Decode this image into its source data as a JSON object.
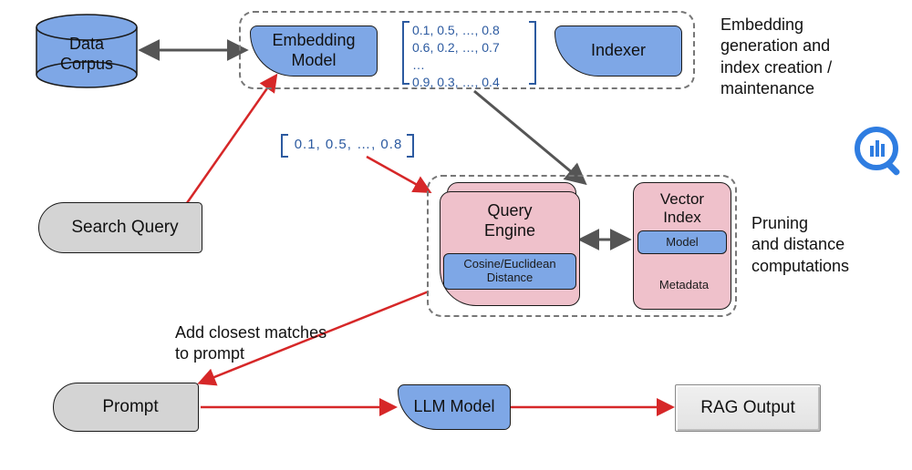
{
  "nodes": {
    "data_corpus": "Data\nCorpus",
    "embedding_model": "Embedding\nModel",
    "indexer": "Indexer",
    "search_query": "Search Query",
    "query_engine": "Query\nEngine",
    "vector_index": "Vector\nIndex",
    "cosine_distance": "Cosine/Euclidean\nDistance",
    "model": "Model",
    "metadata": "Metadata",
    "prompt": "Prompt",
    "llm_model": "LLM Model",
    "rag_output": "RAG Output"
  },
  "matrix": {
    "row1": "0.1, 0.5, …,  0.8",
    "row2": "0.6, 0.2, …,  0.7",
    "ellipsis": "…",
    "row3": "0.9, 0.3, …,  0.4"
  },
  "vector_row": "0.1,  0.5, …,   0.8",
  "labels": {
    "embed_section": "Embedding\ngeneration and\nindex creation /\nmaintenance",
    "vector_section": "Pruning\nand distance\ncomputations",
    "add_matches": "Add closest matches\nto prompt"
  },
  "colors": {
    "blue_fill": "#7ea7e6",
    "blue_stroke": "#2c5aa0",
    "pink_fill": "#efc1cb",
    "gray_fill": "#d4d4d4",
    "red_arrow": "#d62728",
    "dark_arrow": "#555555"
  }
}
